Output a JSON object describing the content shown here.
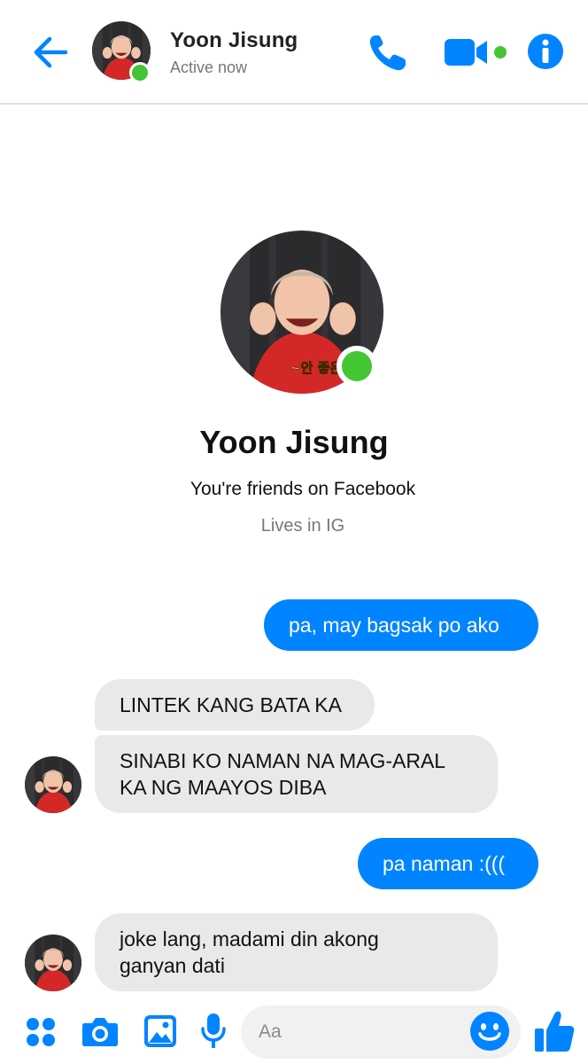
{
  "header": {
    "contact_name": "Yoon Jisung",
    "status": "Active now",
    "icons": [
      "back-arrow-icon",
      "phone-icon",
      "video-camera-icon",
      "info-icon"
    ]
  },
  "profile": {
    "name": "Yoon Jisung",
    "friends_line": "You're friends on Facebook",
    "lives_in": "Lives in IG",
    "avatar_caption": "~안 좋은 눈 삽니다"
  },
  "messages": [
    {
      "direction": "outgoing",
      "text": "pa, may bagsak po ako"
    },
    {
      "direction": "incoming",
      "text": "LINTEK KANG BATA KA"
    },
    {
      "direction": "incoming",
      "lines": [
        "SINABI KO NAMAN NA MAG-ARAL",
        "KA NG MAAYOS DIBA"
      ]
    },
    {
      "direction": "outgoing",
      "text": "pa naman :((("
    },
    {
      "direction": "incoming",
      "lines": [
        "joke lang, madami din akong",
        "ganyan dati"
      ]
    }
  ],
  "composer": {
    "placeholder": "Aa",
    "icons": [
      "apps-grid-icon",
      "camera-icon",
      "gallery-icon",
      "microphone-icon",
      "emoji-icon",
      "thumbs-up-icon"
    ]
  },
  "colors": {
    "accent": "#0084ff",
    "online": "#44c533",
    "incoming_bubble": "#e9e9eb"
  }
}
